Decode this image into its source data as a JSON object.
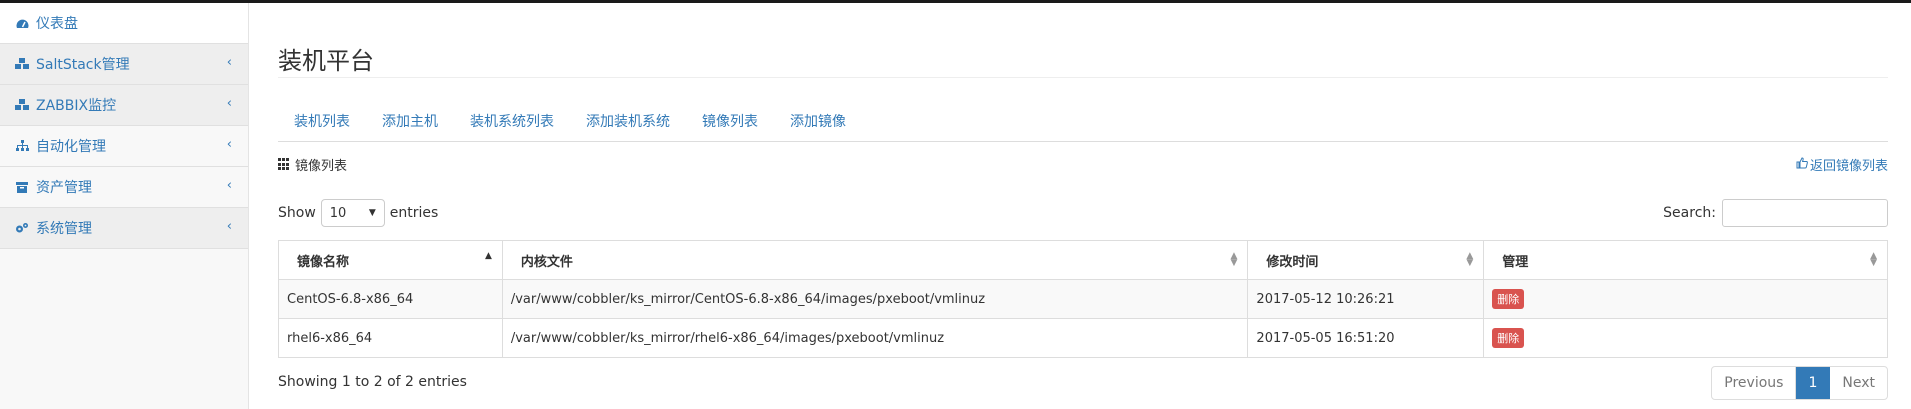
{
  "sidebar": {
    "items": [
      {
        "label": "仪表盘",
        "icon": "dashboard-icon",
        "chevron": ""
      },
      {
        "label": "SaltStack管理",
        "icon": "cubes-icon",
        "chevron": "‹"
      },
      {
        "label": "ZABBIX监控",
        "icon": "cubes-icon",
        "chevron": "‹"
      },
      {
        "label": "自动化管理",
        "icon": "sitemap-icon",
        "chevron": "‹"
      },
      {
        "label": "资产管理",
        "icon": "archive-icon",
        "chevron": "‹"
      },
      {
        "label": "系统管理",
        "icon": "gears-icon",
        "chevron": "‹"
      }
    ]
  },
  "page": {
    "title": "装机平台"
  },
  "tabs": [
    "装机列表",
    "添加主机",
    "装机系统列表",
    "添加装机系统",
    "镜像列表",
    "添加镜像"
  ],
  "panel": {
    "title": "镜像列表",
    "back_link": "返回镜像列表"
  },
  "length": {
    "show": "Show",
    "value": "10",
    "entries": "entries"
  },
  "search": {
    "label": "Search:",
    "value": ""
  },
  "table": {
    "headers": [
      "镜像名称",
      "内核文件",
      "修改时间",
      "管理"
    ],
    "rows": [
      {
        "name": "CentOS-6.8-x86_64",
        "kernel": "/var/www/cobbler/ks_mirror/CentOS-6.8-x86_64/images/pxeboot/vmlinuz",
        "time": "2017-05-12 10:26:21",
        "action": "删除"
      },
      {
        "name": "rhel6-x86_64",
        "kernel": "/var/www/cobbler/ks_mirror/rhel6-x86_64/images/pxeboot/vmlinuz",
        "time": "2017-05-05 16:51:20",
        "action": "删除"
      }
    ]
  },
  "footer": {
    "info": "Showing 1 to 2 of 2 entries"
  },
  "pagination": {
    "previous": "Previous",
    "current": "1",
    "next": "Next"
  },
  "colors": {
    "link": "#337ab7",
    "danger": "#d9534f"
  }
}
